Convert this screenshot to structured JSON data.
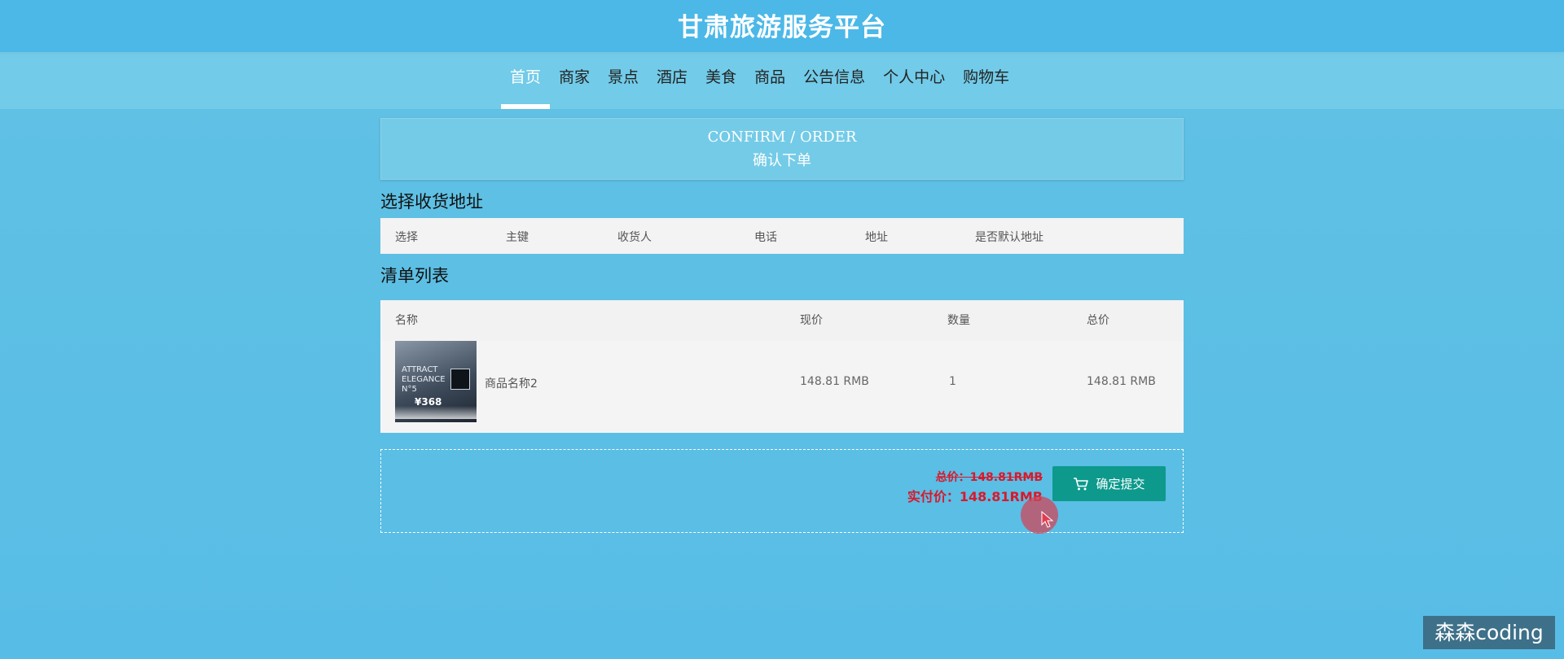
{
  "app": {
    "title": "甘肃旅游服务平台"
  },
  "nav": {
    "items": [
      {
        "label": "首页",
        "active": true
      },
      {
        "label": "商家"
      },
      {
        "label": "景点"
      },
      {
        "label": "酒店"
      },
      {
        "label": "美食"
      },
      {
        "label": "商品"
      },
      {
        "label": "公告信息"
      },
      {
        "label": "个人中心"
      },
      {
        "label": "购物车"
      }
    ]
  },
  "confirm": {
    "title_en": "CONFIRM / ORDER",
    "title_cn": "确认下单"
  },
  "address": {
    "section_title": "选择收货地址",
    "columns": [
      "选择",
      "主键",
      "收货人",
      "电话",
      "地址",
      "是否默认地址"
    ]
  },
  "goods": {
    "section_title": "清单列表",
    "columns": [
      "名称",
      "现价",
      "数量",
      "总价"
    ],
    "rows": [
      {
        "name": "商品名称2",
        "price": "148.81 RMB",
        "quantity": "1",
        "total": "148.81 RMB",
        "image_text": "¥368"
      }
    ]
  },
  "summary": {
    "total_label": "总价：148.81RMB",
    "pay_label": "实付价：148.81RMB",
    "submit_label": "确定提交"
  },
  "watermark": "森森coding",
  "colors": {
    "topbar": "#4bb8e8",
    "submit_button": "#0d9a8d",
    "price_red": "#d9192b"
  }
}
